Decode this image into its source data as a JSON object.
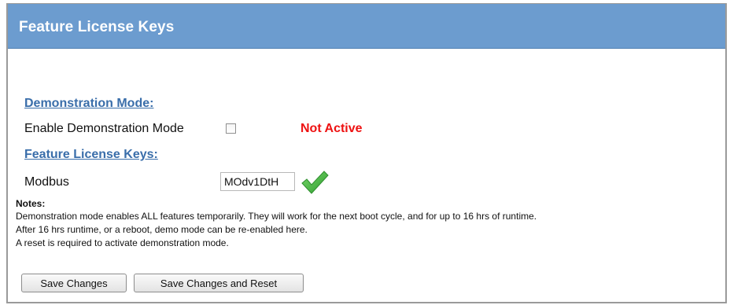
{
  "header": {
    "title": "Feature License Keys"
  },
  "demonstration": {
    "section_title": "Demonstration Mode:",
    "enable_label": "Enable Demonstration Mode",
    "checked": false,
    "status_text": "Not Active",
    "status_color": "#ee1111"
  },
  "license_keys": {
    "section_title": "Feature License Keys:",
    "items": [
      {
        "label": "Modbus",
        "value": "MOdv1DtH",
        "icon": "checkmark-icon",
        "valid": true
      }
    ]
  },
  "notes": {
    "title": "Notes:",
    "lines": [
      "Demonstration mode enables ALL features temporarily. They will work for the next boot cycle, and for up to 16 hrs of runtime.",
      "After 16 hrs runtime, or a reboot, demo mode can be re-enabled here.",
      "A reset is required to activate demonstration mode."
    ]
  },
  "buttons": {
    "save_label": "Save Changes",
    "save_reset_label": "Save Changes and Reset"
  },
  "colors": {
    "header_bg": "#6c9ccf",
    "link": "#3a6eaa"
  }
}
